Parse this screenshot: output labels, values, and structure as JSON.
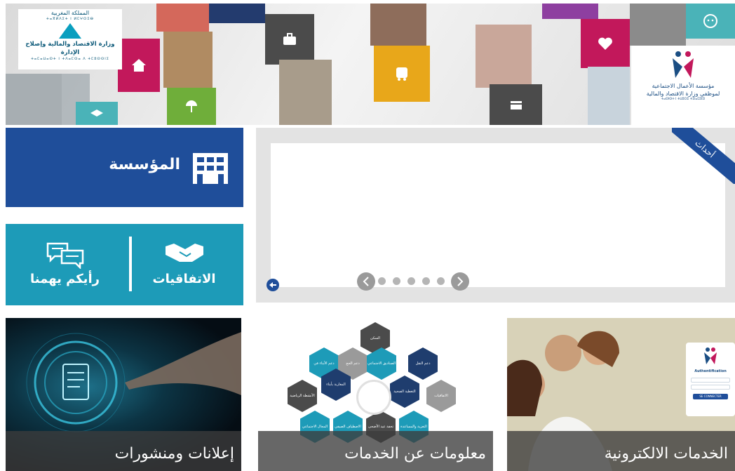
{
  "banner": {
    "left_logo": {
      "kingdom_arabic": "المملكة المغربية",
      "kingdom_tifinagh": "ⵜⴰⴳⵍⴷⵉⵜ ⵏ ⵍⵎⵖⵔⵉⴱ",
      "ministry": "وزارة الاقتصاد والمالية وإصلاح الإدارة",
      "ministry_tifinagh": "ⵜⴰⵎⴰⵡⴰⵙⵜ ⵏ ⵜⴷⴰⵎⵙⴰ ⴷ ⵜⵎⵓⵙⵙⵏⵉ"
    },
    "right_logo": {
      "foundation_line1": "مؤسسة الأعمال الاجتماعية",
      "foundation_line2": "لموظفي وزارة الاقتصاد والمالية",
      "foundation_tifinagh": "ⵜⴰⵙⵏⵙⵜ ⵏ ⵜⵡⵓⵔⵉ ⵜⵉⵏⴰⵎⵓⵏⵉⵏ"
    },
    "colors": {
      "magenta": "#c2185b",
      "dark_grey": "#4b4b4b",
      "teal": "#4ab3b8",
      "yellow": "#e8a71a",
      "purple": "#8e3fa0",
      "green": "#6fae3a",
      "navy": "#233b6e"
    }
  },
  "tiles": {
    "foundation": {
      "label": "المؤسسة",
      "icon": "building-icon",
      "color": "#1f4e9a"
    },
    "agreements": {
      "label": "الاتفاقيات",
      "icon": "handshake-icon"
    },
    "feedback": {
      "label": "رأيكم يهمنا",
      "icon": "chat-bubbles-icon"
    },
    "links_color": "#1d9bb8"
  },
  "events": {
    "ribbon_label": "أحداث",
    "dots_count": 5,
    "prev_icon": "chevron-left-icon",
    "next_icon": "chevron-right-icon"
  },
  "cards": {
    "announcements": {
      "caption": "إعلانات ومنشورات"
    },
    "info": {
      "caption": "معلومات عن الخدمات",
      "hexes": [
        "السكن",
        "دعم الأبناء في وضعية إعاقة",
        "دعم الحج",
        "الصناديق الاجتماعي",
        "دعم النقل",
        "الأنشطة الرياضية والترفيهية",
        "المغاربة بأبناء المتمدرسين",
        "التغطية الصحية",
        "الاتفاقيات والشراكات",
        "المجال الاجتماعي والتضامني",
        "الاصطياف الصيفي",
        "تحفة عيد الأضحى",
        "التعزية والمساعدة الاستثنائية"
      ]
    },
    "eservices": {
      "caption": "الخدمات الالكترونية",
      "form_title": "Authentification",
      "form_button": "SE CONNECTER"
    }
  }
}
